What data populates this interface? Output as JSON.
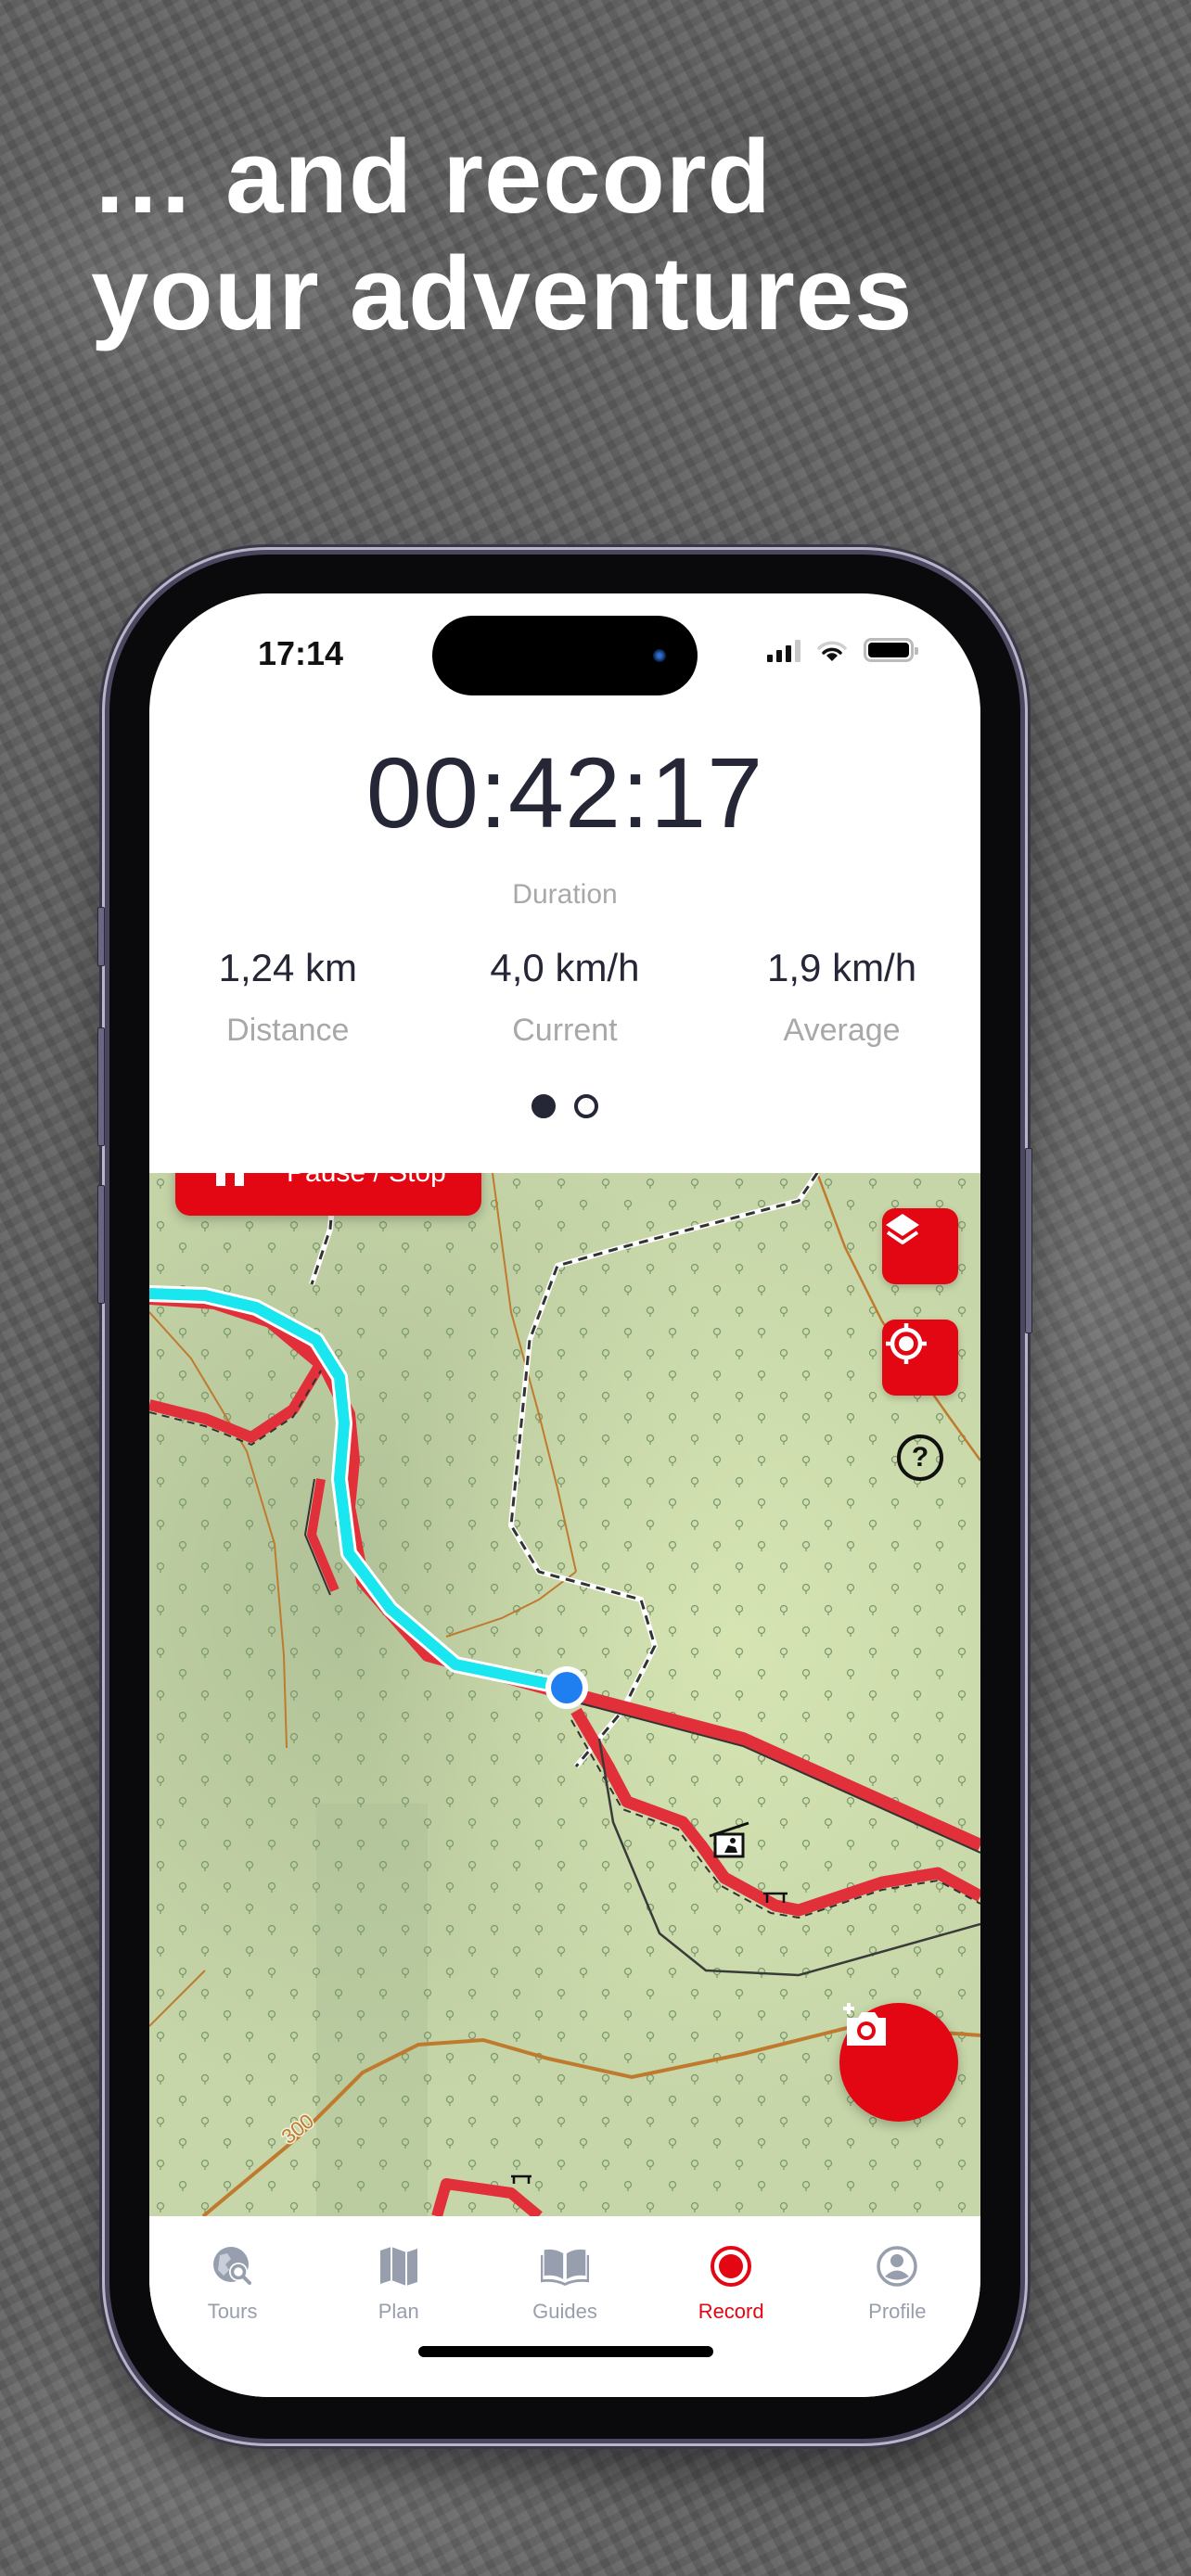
{
  "headline": {
    "line1": "… and record",
    "line2": "your adventures"
  },
  "status_bar": {
    "time": "17:14",
    "icons": [
      "signal-icon",
      "wifi-icon",
      "battery-icon"
    ]
  },
  "recording": {
    "duration_value": "00:42:17",
    "duration_label": "Duration",
    "metrics": [
      {
        "value": "1,24 km",
        "label": "Distance"
      },
      {
        "value": "4,0 km/h",
        "label": "Current"
      },
      {
        "value": "1,9 km/h",
        "label": "Average"
      }
    ],
    "pager": {
      "pages": 2,
      "active_page": 1
    }
  },
  "controls": {
    "pause_stop_label": "Pause / Stop",
    "layers_icon": "layers-icon",
    "locate_icon": "crosshair-locate-icon",
    "help_label": "?",
    "photo_icon": "add-photo-camera-icon"
  },
  "map": {
    "contour_label": "300",
    "colors": {
      "accent": "#e30613",
      "recorded_track": "#19e6ee",
      "trail": "#e2303a",
      "current_position": "#1f7ef0",
      "contour": "#c07a2e",
      "terrain": "#c6d6a8"
    }
  },
  "tabbar": {
    "items": [
      {
        "label": "Tours",
        "icon": "globe-search-icon",
        "active": false
      },
      {
        "label": "Plan",
        "icon": "folded-map-icon",
        "active": false
      },
      {
        "label": "Guides",
        "icon": "open-book-icon",
        "active": false
      },
      {
        "label": "Record",
        "icon": "record-icon",
        "active": true
      },
      {
        "label": "Profile",
        "icon": "profile-icon",
        "active": false
      }
    ]
  }
}
